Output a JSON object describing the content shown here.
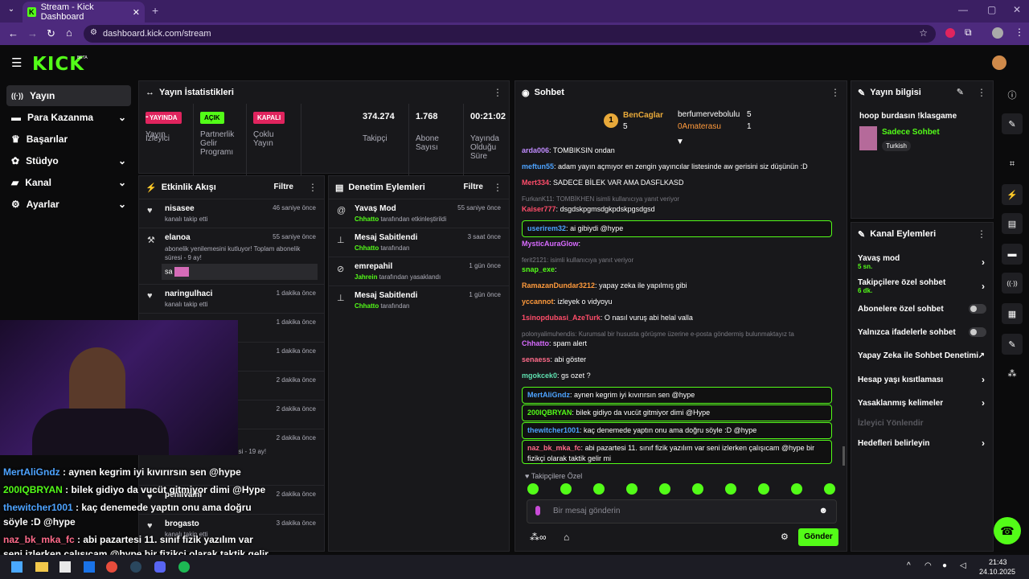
{
  "browser": {
    "tab_title": "Stream - Kick Dashboard",
    "url": "dashboard.kick.com/stream"
  },
  "brand": {
    "logo": "KICK",
    "beta": "BETA",
    "accent": "#53fc18"
  },
  "nav": [
    {
      "label": "Yayın"
    },
    {
      "label": "Para Kazanma"
    },
    {
      "label": "Başarılar"
    },
    {
      "label": "Stüdyo"
    },
    {
      "label": "Kanal"
    },
    {
      "label": "Ayarlar"
    }
  ],
  "stats": {
    "title": "Yayın İstatistikleri",
    "items": [
      {
        "badge": "YAYINDA",
        "label": "Yayın"
      },
      {
        "badge": "AÇIK",
        "label": "Partnerlik Gelir Programı"
      },
      {
        "badge": "KAPALI",
        "label": "Çoklu Yayın"
      },
      {
        "value": "-",
        "label": "İzleyici"
      },
      {
        "value": "374.274",
        "label": "Takipçi"
      },
      {
        "value": "1.768",
        "label": "Abone Sayısı"
      },
      {
        "value": "00:21:02",
        "label": "Yayında Olduğu Süre"
      }
    ]
  },
  "activity": {
    "title": "Etkinlik Akışı",
    "filter": "Filtre",
    "events": [
      {
        "name": "nisasee",
        "sub": "kanalı takip etti",
        "time": "46 saniye önce"
      },
      {
        "name": "elanoa",
        "sub": "abonelik yenilemesini kutluyor! Toplam abonelik süresi - 9 ay!",
        "time": "55 saniye önce",
        "msg": "sa"
      },
      {
        "name": "naringulhaci",
        "sub": "kanalı takip etti",
        "time": "1 dakika önce"
      },
      {
        "time": "1 dakika önce"
      },
      {
        "time": "1 dakika önce"
      },
      {
        "time": "2 dakika önce"
      },
      {
        "time": "2 dakika önce"
      },
      {
        "sub": "uyor! Toplam abonelik süresi - 19 ay!",
        "time": "2 dakika önce"
      },
      {
        "name": "penilvalhi",
        "time": "2 dakika önce"
      },
      {
        "name": "brogasto",
        "sub": "kanalı takip etti",
        "time": "3 dakika önce"
      }
    ]
  },
  "moderation": {
    "title": "Denetim Eylemleri",
    "filter": "Filtre",
    "events": [
      {
        "name": "Yavaş Mod",
        "who": "Chhatto",
        "sub": "tarafından etkinleştirildi",
        "time": "55 saniye önce"
      },
      {
        "name": "Mesaj Sabitlendi",
        "who": "Chhatto",
        "sub": "tarafından",
        "time": "3 saat önce"
      },
      {
        "name": "emrepahil",
        "who": "Jahrein",
        "sub": "tarafından yasaklandı",
        "time": "1 gün önce"
      },
      {
        "name": "Mesaj Sabitlendi",
        "who": "Chhatto",
        "sub": "tarafından",
        "time": "1 gün önce"
      }
    ]
  },
  "chat": {
    "title": "Sohbet",
    "leaders": [
      {
        "rank": "1",
        "name": "BenCaglar",
        "count": "5"
      },
      {
        "name": "berfumervebolulu",
        "count": "5"
      },
      {
        "name": "0Amaterasu",
        "count": "1"
      }
    ],
    "messages": [
      {
        "user": "arda006",
        "text": "TOMBIKSIN ondan",
        "color": "#c08cff"
      },
      {
        "user": "meftun55",
        "text": "adam yayın açmıyor en zengin yayıncılar listesinde aw gerisini siz düşünün :D",
        "color": "#4da3ff"
      },
      {
        "user": "Mert334",
        "text": "SADECE BİLEK VAR AMA DASFLKASD",
        "color": "#ff4d6a"
      },
      {
        "reply": "FurkanK11: TOMBİKHEN isimli kullanıcıya yanıt veriyor"
      },
      {
        "user": "Kaiser777",
        "text": "dsgdskpgmsdgkpdskpgsdgsd",
        "color": "#ff4d6a"
      },
      {
        "user": "userirem32",
        "text": "ai gibiydi @hype",
        "color": "#4da3ff",
        "hl": true
      },
      {
        "user": "MysticAuraGlow",
        "text": "",
        "color": "#d86bff"
      },
      {
        "reply": "ferit2121: isimli kullanıcıya yanıt veriyor"
      },
      {
        "user": "snap_exe",
        "text": "",
        "color": "#53fc18"
      },
      {
        "user": "RamazanDundar3212",
        "text": "yapay zeka ile yapılmış gibi",
        "color": "#ff9a3c"
      },
      {
        "user": "yccannot",
        "text": "izleyek o vidyoyu",
        "color": "#ff9a3c"
      },
      {
        "user": "1sinopdubasi_AzeTurk",
        "text": "O nasıl vuruş abi helal valla",
        "color": "#ff4d6a"
      },
      {
        "reply": "polonyalimuhendis: Kurumsal bir hususta görüşme üzerine e-posta göndermiş bulunmaktayız ta"
      },
      {
        "user": "Chhatto",
        "text": "spam alert",
        "color": "#d86bff"
      },
      {
        "user": "senaess",
        "text": "abi göster",
        "color": "#ff6b8a"
      },
      {
        "user": "mgokcek0",
        "text": "gs ozet ?",
        "color": "#5ee0b0"
      },
      {
        "user": "MertAliGndz",
        "text": "aynen kegrim iyi kıvırırsın sen @hype",
        "color": "#4da3ff",
        "hl": true
      },
      {
        "user": "200IQBRYAN",
        "text": "bilek gidiyo da vucüt gitmiyor dimi @Hype",
        "color": "#53fc18",
        "hl": true
      },
      {
        "user": "thewitcher1001",
        "text": "kaç denemede yaptın onu ama doğru söyle :D @hype",
        "color": "#4da3ff",
        "hl": true
      },
      {
        "user": "naz_bk_mka_fc",
        "text": "abi pazartesi 11. sınıf fizik yazılım var seni izlerken çalışıcam @hype bir fizikçi olarak taktik gelir mi",
        "color": "#ff6b8a",
        "hl": true
      }
    ],
    "followers_only": "Takipçilere Özel",
    "placeholder": "Bir mesaj gönderin",
    "send": "Gönder"
  },
  "streaminfo": {
    "title": "Yayın bilgisi",
    "stream_title": "hoop burdasın !klasgame",
    "category": "Sadece Sohbet",
    "tag": "Turkish"
  },
  "channel_actions": {
    "title": "Kanal Eylemleri",
    "items": [
      {
        "label": "Yavaş mod",
        "sub": "5 sn.",
        "type": "chev"
      },
      {
        "label": "Takipçilere özel sohbet",
        "sub": "6 dk.",
        "type": "chev"
      },
      {
        "label": "Abonelere özel sohbet",
        "type": "toggle"
      },
      {
        "label": "Yalnızca ifadelerle sohbet",
        "type": "toggle"
      },
      {
        "label": "Yapay Zeka ile Sohbet Denetimi",
        "type": "ext"
      },
      {
        "label": "Hesap yaşı kısıtlaması",
        "type": "chev"
      },
      {
        "label": "Yasaklanmış kelimeler",
        "type": "chev"
      },
      {
        "label": "İzleyici Yönlendir",
        "type": "disabled"
      },
      {
        "label": "Hedefleri belirleyin",
        "type": "chev"
      }
    ]
  },
  "overlay": {
    "lines": [
      {
        "user": "MertAliGndz",
        "text": " : aynen kegrim iyi kıvırırsın sen @hype",
        "color": "#4da3ff"
      },
      {
        "user": "200IQBRYAN",
        "text": " : bilek gidiyo da vucüt gitmiyor dimi @Hype",
        "color": "#53fc18"
      },
      {
        "user": "thewitcher1001",
        "text": " : kaç denemede yaptın onu ama doğru",
        "color": "#4da3ff"
      },
      {
        "user": "",
        "text": "söyle :D @hype",
        "color": "#fff"
      },
      {
        "user": "naz_bk_mka_fc",
        "text": " : abi pazartesi 11. sınıf fizik yazılım var",
        "color": "#ff6b8a"
      },
      {
        "user": "",
        "text": "seni izlerken çalışıcam @hype bir fizikçi olarak taktik gelir",
        "color": "#fff"
      }
    ]
  },
  "taskbar": {
    "time": "21:43",
    "date": "24.10.2025"
  }
}
